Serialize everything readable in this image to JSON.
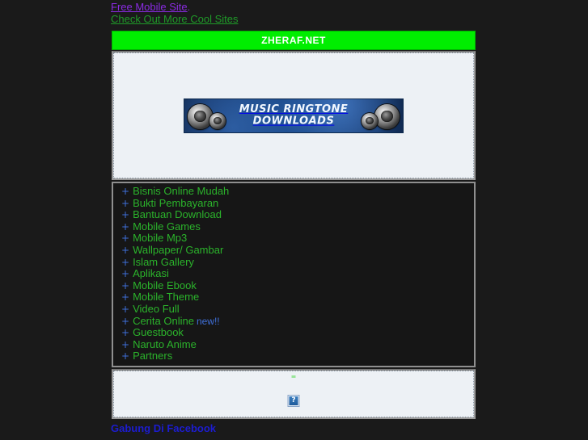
{
  "top_links": {
    "free_mobile_site": "Free Mobile Site",
    "period": ".",
    "check_out_more": "Check Out More Cool Sites"
  },
  "header": {
    "title": "ZHERAF.NET",
    "title_bg": "#00ee00",
    "title_color": "#ffffff"
  },
  "banner": {
    "line1": "MUSIC RINGTONE",
    "line2": "DOWNLOADS",
    "bg_color": "#16386b",
    "text_color": "#f2f8ff",
    "icon_left_large": "speaker-icon",
    "icon_left_small": "speaker-icon",
    "icon_right_large": "speaker-icon",
    "icon_right_small": "speaker-icon"
  },
  "menu": {
    "bullet_glyph": "+",
    "bullet_color": "#3f6fd8",
    "link_color": "#2bb32b",
    "items": [
      {
        "label": "Bisnis Online Mudah",
        "flag": ""
      },
      {
        "label": "Bukti Pembayaran",
        "flag": ""
      },
      {
        "label": "Bantuan Download",
        "flag": ""
      },
      {
        "label": "Mobile Games",
        "flag": ""
      },
      {
        "label": "Mobile Mp3",
        "flag": ""
      },
      {
        "label": "Wallpaper/ Gambar",
        "flag": ""
      },
      {
        "label": "Islam Gallery",
        "flag": ""
      },
      {
        "label": "Aplikasi",
        "flag": ""
      },
      {
        "label": "Mobile Ebook",
        "flag": ""
      },
      {
        "label": "Mobile Theme",
        "flag": ""
      },
      {
        "label": "Video Full",
        "flag": ""
      },
      {
        "label": "Cerita Online",
        "flag": "new!!"
      },
      {
        "label": "Guestbook",
        "flag": ""
      },
      {
        "label": "Naruto Anime",
        "flag": ""
      },
      {
        "label": "Partners",
        "flag": ""
      }
    ]
  },
  "bottom_panel": {
    "dash": "-",
    "broken_image_icon": "broken-image-placeholder-icon",
    "broken_image_glyph": "?"
  },
  "footer": {
    "facebook_link": "Gabung Di Facebook"
  }
}
